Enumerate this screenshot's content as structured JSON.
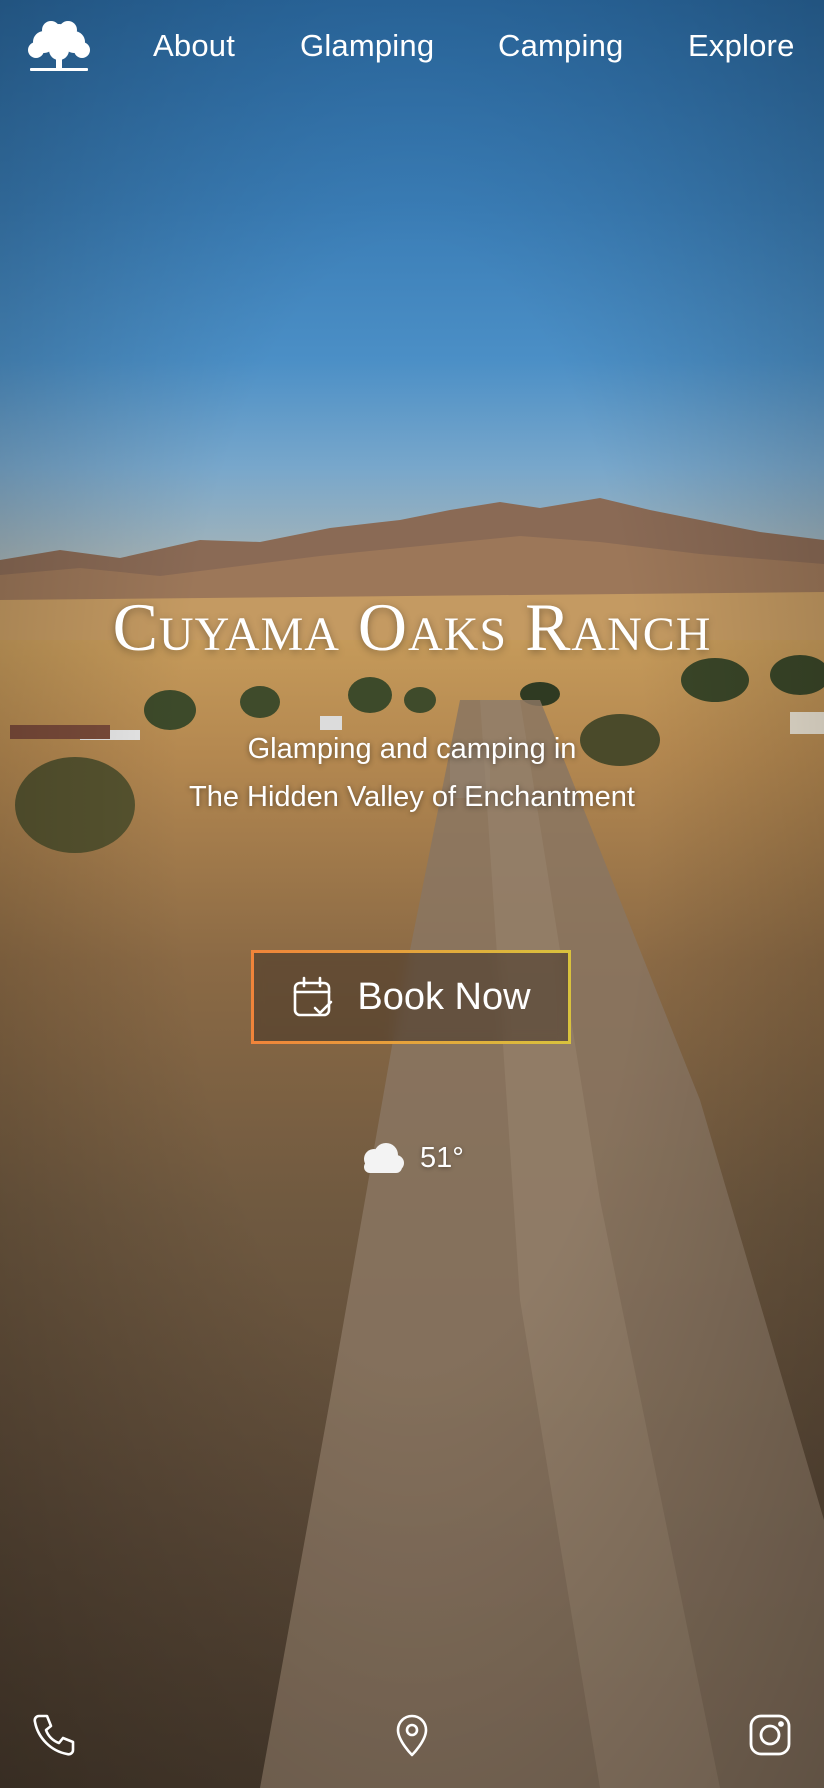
{
  "nav": {
    "logo_icon": "oak-tree-icon",
    "links": [
      {
        "label": "About"
      },
      {
        "label": "Glamping"
      },
      {
        "label": "Camping"
      },
      {
        "label": "Explore"
      }
    ]
  },
  "hero": {
    "title": "Cuyama Oaks Ranch",
    "subtitle_line1": "Glamping and camping in",
    "subtitle_line2": "The Hidden Valley of Enchantment",
    "book_button": {
      "label": "Book Now",
      "icon": "calendar-check-icon"
    }
  },
  "weather": {
    "icon": "cloud-icon",
    "temperature": "51°"
  },
  "footer_icons": [
    {
      "name": "phone-icon"
    },
    {
      "name": "map-pin-icon"
    },
    {
      "name": "instagram-icon"
    }
  ],
  "colors": {
    "sky": "#3a7db6",
    "button_border_start": "#f0843a",
    "button_border_end": "#d9c23d",
    "text": "#ffffff"
  }
}
